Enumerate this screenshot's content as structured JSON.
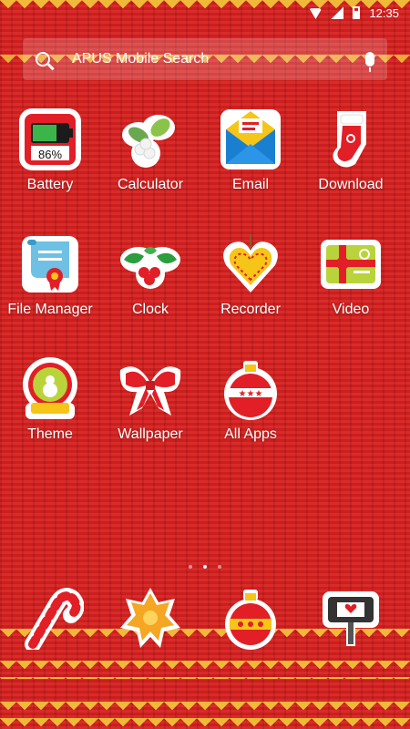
{
  "status_bar": {
    "time": "12:35"
  },
  "search": {
    "placeholder": "APUS Mobile Search"
  },
  "apps": [
    {
      "label": "Battery",
      "percent": "86%",
      "icon": "battery-icon"
    },
    {
      "label": "Calculator",
      "icon": "mistletoe-icon"
    },
    {
      "label": "Email",
      "icon": "envelope-icon"
    },
    {
      "label": "Download",
      "icon": "stocking-icon"
    },
    {
      "label": "File Manager",
      "icon": "scroll-icon"
    },
    {
      "label": "Clock",
      "icon": "holly-icon"
    },
    {
      "label": "Recorder",
      "icon": "heart-ornament-icon"
    },
    {
      "label": "Video",
      "icon": "gift-card-icon"
    },
    {
      "label": "Theme",
      "icon": "snow-globe-icon"
    },
    {
      "label": "Wallpaper",
      "icon": "bow-icon"
    },
    {
      "label": "All Apps",
      "icon": "bauble-icon"
    }
  ],
  "dock": [
    {
      "icon": "candy-cane-icon"
    },
    {
      "icon": "star-cookie-icon"
    },
    {
      "icon": "ornament-icon"
    },
    {
      "icon": "mailbox-icon"
    }
  ],
  "colors": {
    "background": "#d6201f",
    "accent_yellow": "#f1c23a"
  }
}
